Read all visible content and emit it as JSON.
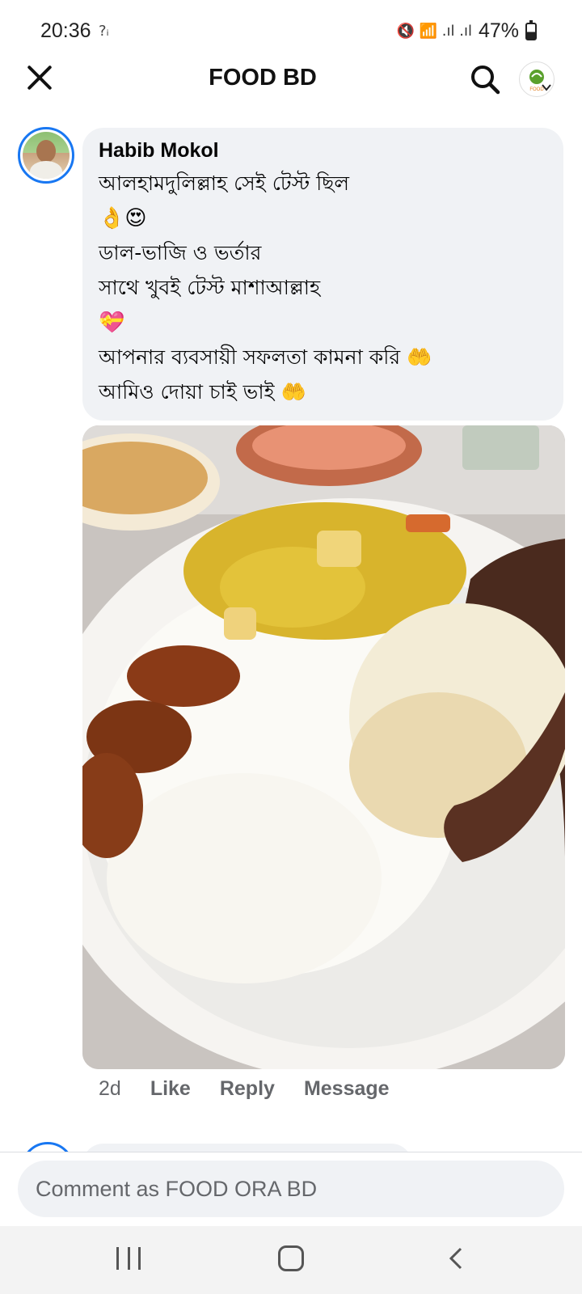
{
  "status_bar": {
    "time": "20:36",
    "left_indicator": "?ᵢ",
    "right_glyphs": "🔇 📶 .ıl .ıl",
    "battery": "47%"
  },
  "header": {
    "title": "FOOD BD",
    "page_logo_text": "FOOD"
  },
  "comment": {
    "author": "Habib Mokol",
    "lines": [
      "আলহামদুলিল্লাহ সেই টেস্ট ছিল",
      "👌😍",
      "ডাল-ভাজি ও ভর্তার",
      "সাথে খুবই টেস্ট মাশাআল্লাহ",
      "💝",
      "আপনার ব্যবসায়ী সফলতা কামনা করি 🤲",
      "আমিও দোয়া চাই ভাই 🤲"
    ],
    "timestamp": "2d",
    "actions": [
      "Like",
      "Reply",
      "Message"
    ]
  },
  "composer": {
    "placeholder": "Comment as FOOD ORA BD"
  },
  "colors": {
    "accent": "#1877f2",
    "bubble_bg": "#f0f2f5",
    "secondary_text": "#65676b"
  },
  "icons": {
    "close": "close-icon",
    "search": "search-icon",
    "chevron": "chevron-down-icon",
    "nav_recent": "recent-apps-icon",
    "nav_home": "home-icon",
    "nav_back": "back-icon"
  }
}
